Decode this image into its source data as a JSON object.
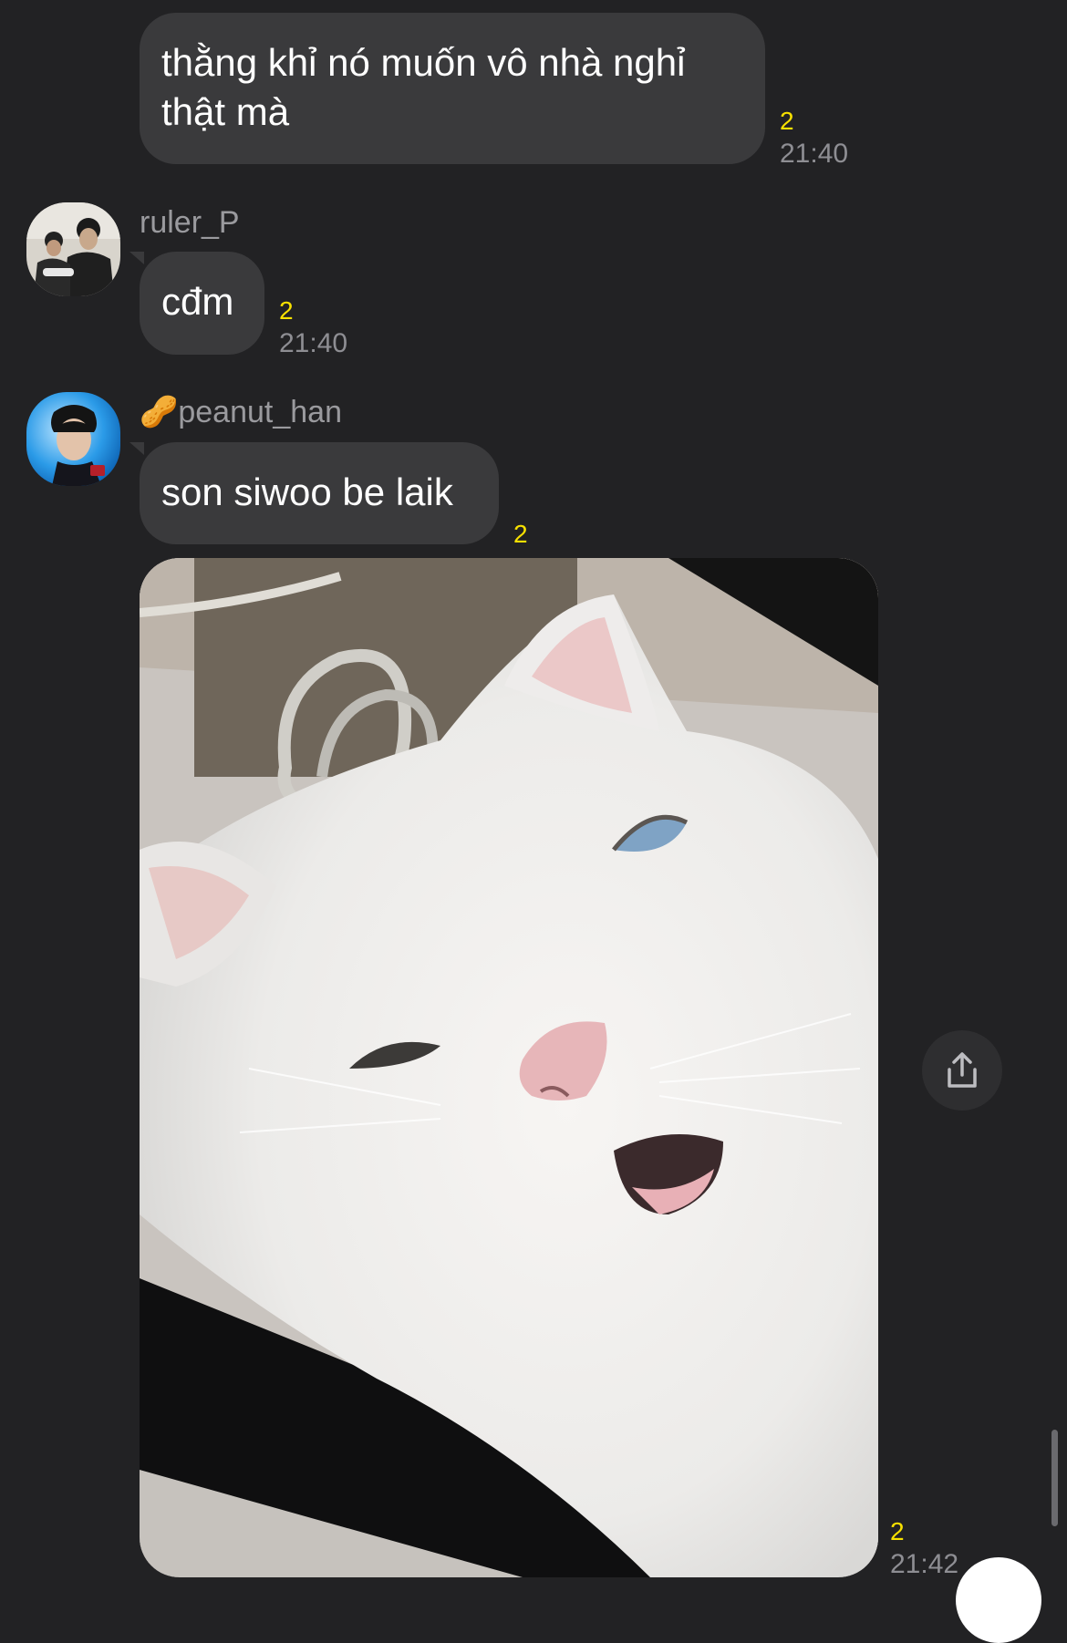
{
  "messages": [
    {
      "text": "thằng khỉ nó muốn vô nhà nghỉ thật mà",
      "unread": "2",
      "time": "21:40"
    },
    {
      "sender": "ruler_P",
      "text": "cđm",
      "unread": "2",
      "time": "21:40"
    },
    {
      "sender_emoji": "🥜",
      "sender": "peanut_han",
      "text": "son siwoo be laik",
      "unread": "2"
    },
    {
      "type": "image",
      "image_subject": "white cat",
      "unread": "2",
      "time": "21:42"
    }
  ],
  "icons": {
    "share": "share-icon",
    "scroll_down": "scroll-down-button"
  },
  "colors": {
    "background": "#222224",
    "bubble": "#3a3a3c",
    "unread": "#f7e000",
    "meta": "#8e8e93"
  }
}
